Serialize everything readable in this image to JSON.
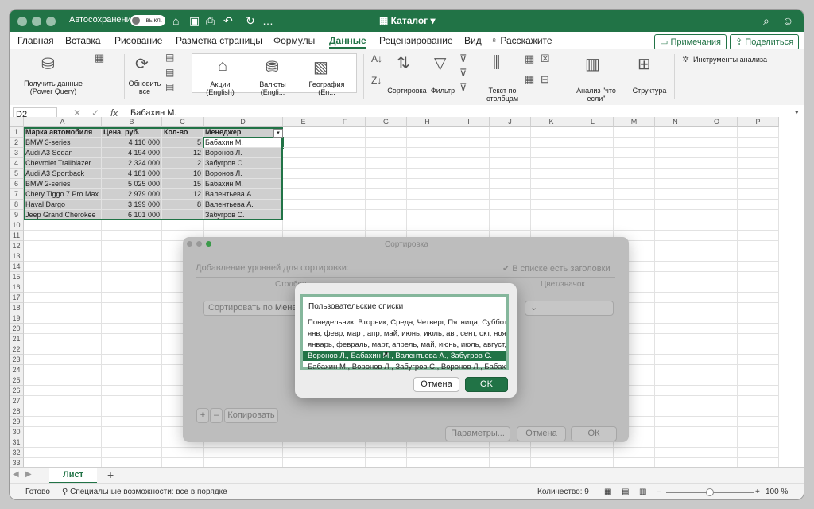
{
  "titlebar": {
    "autosave_label": "Автосохранение",
    "autosave_state": "выкл.",
    "doc_title": "Каталог",
    "accent": "#217346"
  },
  "menu": {
    "items": [
      "Главная",
      "Вставка",
      "Рисование",
      "Разметка страницы",
      "Формулы",
      "Данные",
      "Рецензирование",
      "Вид"
    ],
    "active": "Данные",
    "tell_me": "Расскажите",
    "comments": "Примечания",
    "share": "Поделиться"
  },
  "ribbon": {
    "get_data": "Получить данные (Power Query)",
    "refresh_all": "Обновить все",
    "gallery": [
      "Акции (English)",
      "Валюты (Engli...",
      "География (En..."
    ],
    "sort": "Сортировка",
    "filter": "Фильтр",
    "text_to_columns": "Текст по столбцам",
    "what_if": "Анализ \"что если\"",
    "outline": "Структура",
    "analysis_tools": "Инструменты анализа"
  },
  "formula_bar": {
    "cell_ref": "D2",
    "fx": "fx",
    "value": "Бабахин М."
  },
  "sheet": {
    "columns": [
      "A",
      "B",
      "C",
      "D",
      "E",
      "F",
      "G",
      "H",
      "I",
      "J",
      "K",
      "L",
      "M",
      "N",
      "O",
      "P"
    ],
    "header": [
      "Марка автомобиля",
      "Цена, руб.",
      "Кол-во",
      "Менеджер"
    ],
    "rows": [
      [
        "BMW 3-series",
        "4 110 000",
        "5",
        "Бабахин М."
      ],
      [
        "Audi A3 Sedan",
        "4 194 000",
        "12",
        "Воронов Л."
      ],
      [
        "Chevrolet Trailblazer",
        "2 324 000",
        "2",
        "Забугров С."
      ],
      [
        "Audi A3 Sportback",
        "4 181 000",
        "10",
        "Воронов Л."
      ],
      [
        "BMW 2-series",
        "5 025 000",
        "15",
        "Бабахин М."
      ],
      [
        "Chery Tiggo 7 Pro Max",
        "2 979 000",
        "12",
        "Валентьева А."
      ],
      [
        "Haval Dargo",
        "3 199 000",
        "8",
        "Валентьева А."
      ],
      [
        "Jeep Grand Cherokee",
        "6 101 000",
        "",
        "Забугров С."
      ]
    ],
    "row_numbers": [
      "1",
      "2",
      "3",
      "4",
      "5",
      "6",
      "7",
      "8",
      "9",
      "10",
      "11",
      "12",
      "13",
      "14",
      "15",
      "16",
      "17",
      "18",
      "19",
      "20",
      "21",
      "22",
      "23",
      "24",
      "25",
      "26",
      "27",
      "28",
      "29",
      "30",
      "31",
      "32",
      "33"
    ]
  },
  "sort_dialog": {
    "title": "Сортировка",
    "add_levels": "Добавление уровней для сортировки:",
    "has_headers": "В списке есть заголовки",
    "col_header_column": "Столбец",
    "col_header_color": "Цвет/значок",
    "sort_by": "Сортировать по",
    "sort_by_value": "Менеджер",
    "add": "+",
    "remove": "–",
    "copy": "Копировать",
    "params": "Параметры...",
    "cancel": "Отмена",
    "ok": "ОК"
  },
  "custom_lists": {
    "title": "Пользовательские списки",
    "items": [
      "Понедельник, Вторник, Среда, Четверг, Пятница, Суббота, Воскресенье",
      "янв, февр, март, апр, май, июнь, июль, авг, сент, окт, нояб, дек",
      "январь, февраль, март, апрель, май, июнь, июль, август, сентябрь",
      "Воронов Л., Бабахин М., Валентьева А., Забугров С.",
      "Бабахин М., Воронов Л., Забугров С., Воронов Л., Бабахин М."
    ],
    "selected_index": 3,
    "cancel": "Отмена",
    "ok": "OK"
  },
  "sheet_tabs": {
    "active": "Лист",
    "add": "+"
  },
  "status": {
    "ready": "Готово",
    "accessibility": "Специальные возможности: все в порядке",
    "count": "Количество: 9",
    "zoom_text": "100 %",
    "zoom_fraction": 0.5
  }
}
